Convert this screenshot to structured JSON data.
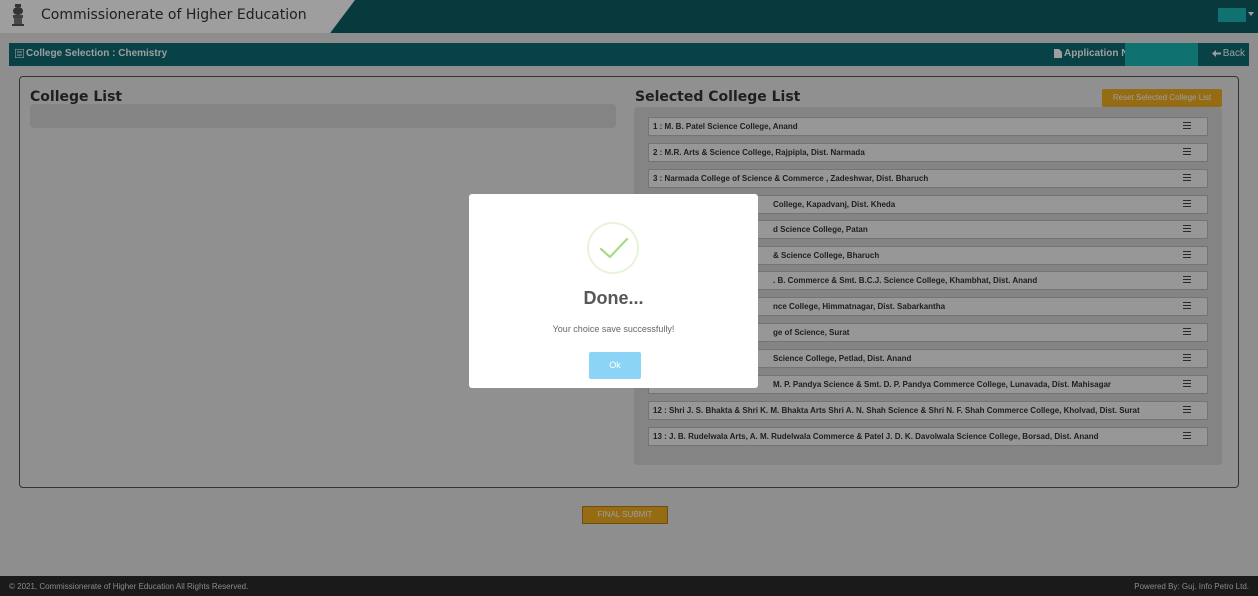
{
  "header": {
    "brand": "Commissionerate of Higher Education"
  },
  "secondary_bar": {
    "page_title": "College Selection : Chemistry",
    "application_label": "Application No:",
    "back_label": "Back"
  },
  "college_list": {
    "title": "College List"
  },
  "selected_college_list": {
    "title": "Selected College List",
    "reset_label": "Reset Selected College List",
    "items": [
      "1 : M. B. Patel Science College, Anand",
      "2 : M.R. Arts & Science College, Rajpipla, Dist. Narmada",
      "3 : Narmada College of Science & Commerce , Zadeshwar, Dist. Bharuch",
      "College, Kapadvanj, Dist. Kheda",
      "d Science College, Patan",
      "& Science College, Bharuch",
      ". B. Commerce & Smt. B.C.J. Science College, Khambhat, Dist. Anand",
      "nce College, Himmatnagar, Dist. Sabarkantha",
      "ge of Science, Surat",
      "Science College, Petlad, Dist. Anand",
      "M. P. Pandya Science & Smt. D. P. Pandya Commerce College, Lunavada, Dist. Mahisagar",
      "12 : Shri J. S. Bhakta & Shri K. M. Bhakta Arts Shri A. N. Shah Science & Shri N. F. Shah Commerce College, Kholvad, Dist. Surat",
      "13 : J. B. Rudelwala Arts, A. M. Rudelwala Commerce & Patel J. D. K. Davolwala Science College, Borsad, Dist. Anand"
    ]
  },
  "final_submit_label": "FINAL SUBMIT",
  "footer": {
    "copyright": "© 2021, Commissionerate of Higher Education All Rights Reserved.",
    "powered_by": "Powered By: Guj. Info Petro Ltd."
  },
  "dialog": {
    "title": "Done...",
    "message": "Your choice save successfully!",
    "ok_label": "Ok"
  },
  "icons": {
    "emblem": "national-emblem-icon",
    "page": "list-icon",
    "application": "file-icon",
    "back": "back-arrow-icon",
    "drag": "drag-handle-icon",
    "success": "checkmark-icon"
  },
  "colors": {
    "header_teal": "#0d5c63",
    "accent_teal": "#1ab7b7",
    "warning_orange": "#f0ad1f",
    "ok_blue": "#8cd4f5",
    "success_green": "#a5dc86"
  }
}
